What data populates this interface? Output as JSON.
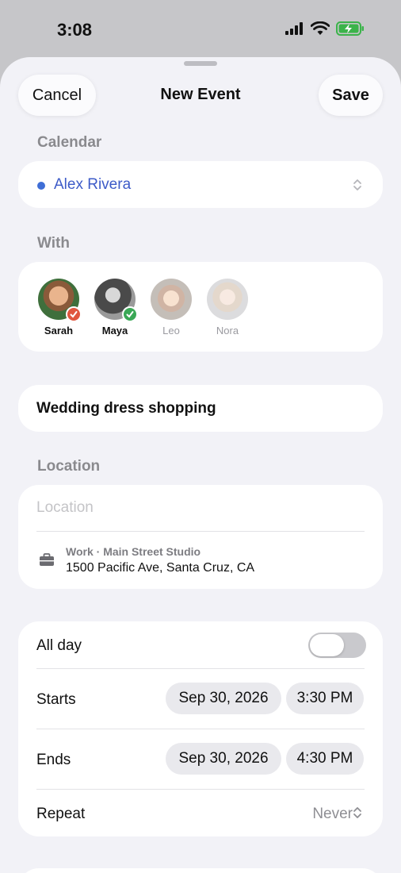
{
  "status": {
    "time": "3:08"
  },
  "nav": {
    "cancel": "Cancel",
    "title": "New Event",
    "save": "Save"
  },
  "calendar": {
    "label": "Calendar",
    "name": "Alex Rivera",
    "dot_color": "#3f6ed6"
  },
  "with": {
    "label": "With",
    "people": [
      {
        "name": "Sarah",
        "status": "declined",
        "badge_color": "#e0563f"
      },
      {
        "name": "Maya",
        "status": "accepted",
        "badge_color": "#3aa856"
      },
      {
        "name": "Leo",
        "status": "pending"
      },
      {
        "name": "Nora",
        "status": "pending"
      }
    ]
  },
  "event": {
    "title": "Wedding dress shopping"
  },
  "location": {
    "label": "Location",
    "placeholder": "Location",
    "suggestion_sub": "Work · Main Street Studio",
    "suggestion_address": "1500 Pacific Ave, Santa Cruz, CA",
    "suggestion_icon": "briefcase-icon"
  },
  "schedule": {
    "all_day_label": "All day",
    "all_day": false,
    "starts_label": "Starts",
    "start_date": "Sep 30, 2026",
    "start_time": "3:30 PM",
    "ends_label": "Ends",
    "end_date": "Sep 30, 2026",
    "end_time": "4:30 PM",
    "repeat_label": "Repeat",
    "repeat_value": "Never"
  }
}
